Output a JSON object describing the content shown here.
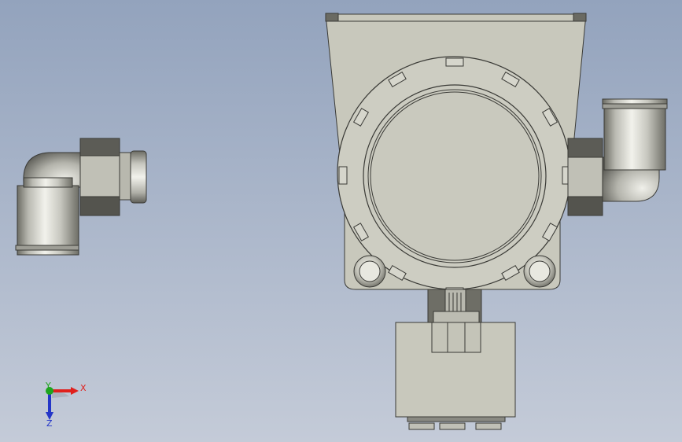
{
  "viewport": {
    "background_top": "#93a3bd",
    "background_bottom": "#c4cbd8"
  },
  "parts": [
    {
      "name": "left-elbow-fitting"
    },
    {
      "name": "transmitter-housing"
    },
    {
      "name": "right-elbow-fitting"
    }
  ],
  "triad": {
    "x_label": "X",
    "y_label": "Y",
    "z_label": "Z",
    "x_color": "#e0201c",
    "y_color": "#1ea51e",
    "z_color": "#2436c8"
  }
}
